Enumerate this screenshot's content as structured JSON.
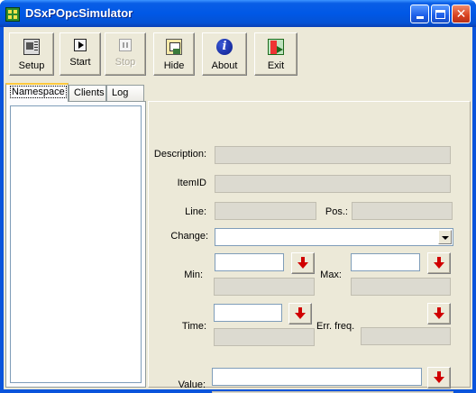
{
  "window": {
    "title": "DSxPOpcSimulator"
  },
  "toolbar": {
    "buttons": [
      {
        "label": "Setup",
        "icon": "setup-icon",
        "enabled": true
      },
      {
        "label": "Start",
        "icon": "play-icon",
        "enabled": true
      },
      {
        "label": "Stop",
        "icon": "pause-icon",
        "enabled": false
      },
      {
        "label": "Hide",
        "icon": "hide-icon",
        "enabled": true
      },
      {
        "label": "About",
        "icon": "info-icon",
        "enabled": true
      },
      {
        "label": "Exit",
        "icon": "exit-door-icon",
        "enabled": true
      }
    ]
  },
  "tabs": [
    {
      "label": "Namespace",
      "active": true
    },
    {
      "label": "Clients",
      "active": false
    },
    {
      "label": "Log",
      "active": false
    }
  ],
  "properties": {
    "description_label": "Description:",
    "description_value": "",
    "itemid_label": "ItemID",
    "itemid_value": "",
    "line_label": "Line:",
    "line_value": "",
    "pos_label": "Pos.:",
    "pos_value": "",
    "change_label": "Change:",
    "change_value": "",
    "min_label": "Min:",
    "min_input": "",
    "min_display": "",
    "max_label": "Max:",
    "max_input": "",
    "max_display": "",
    "time_label": "Time:",
    "time_input": "",
    "time_display": "",
    "errfreq_label": "Err. freq.",
    "errfreq_display": "",
    "value_label": "Value:",
    "value_input": "",
    "value_display": ""
  },
  "colors": {
    "titlebar": "#0058e6",
    "face": "#ece9d8",
    "arrow": "#d00000"
  }
}
